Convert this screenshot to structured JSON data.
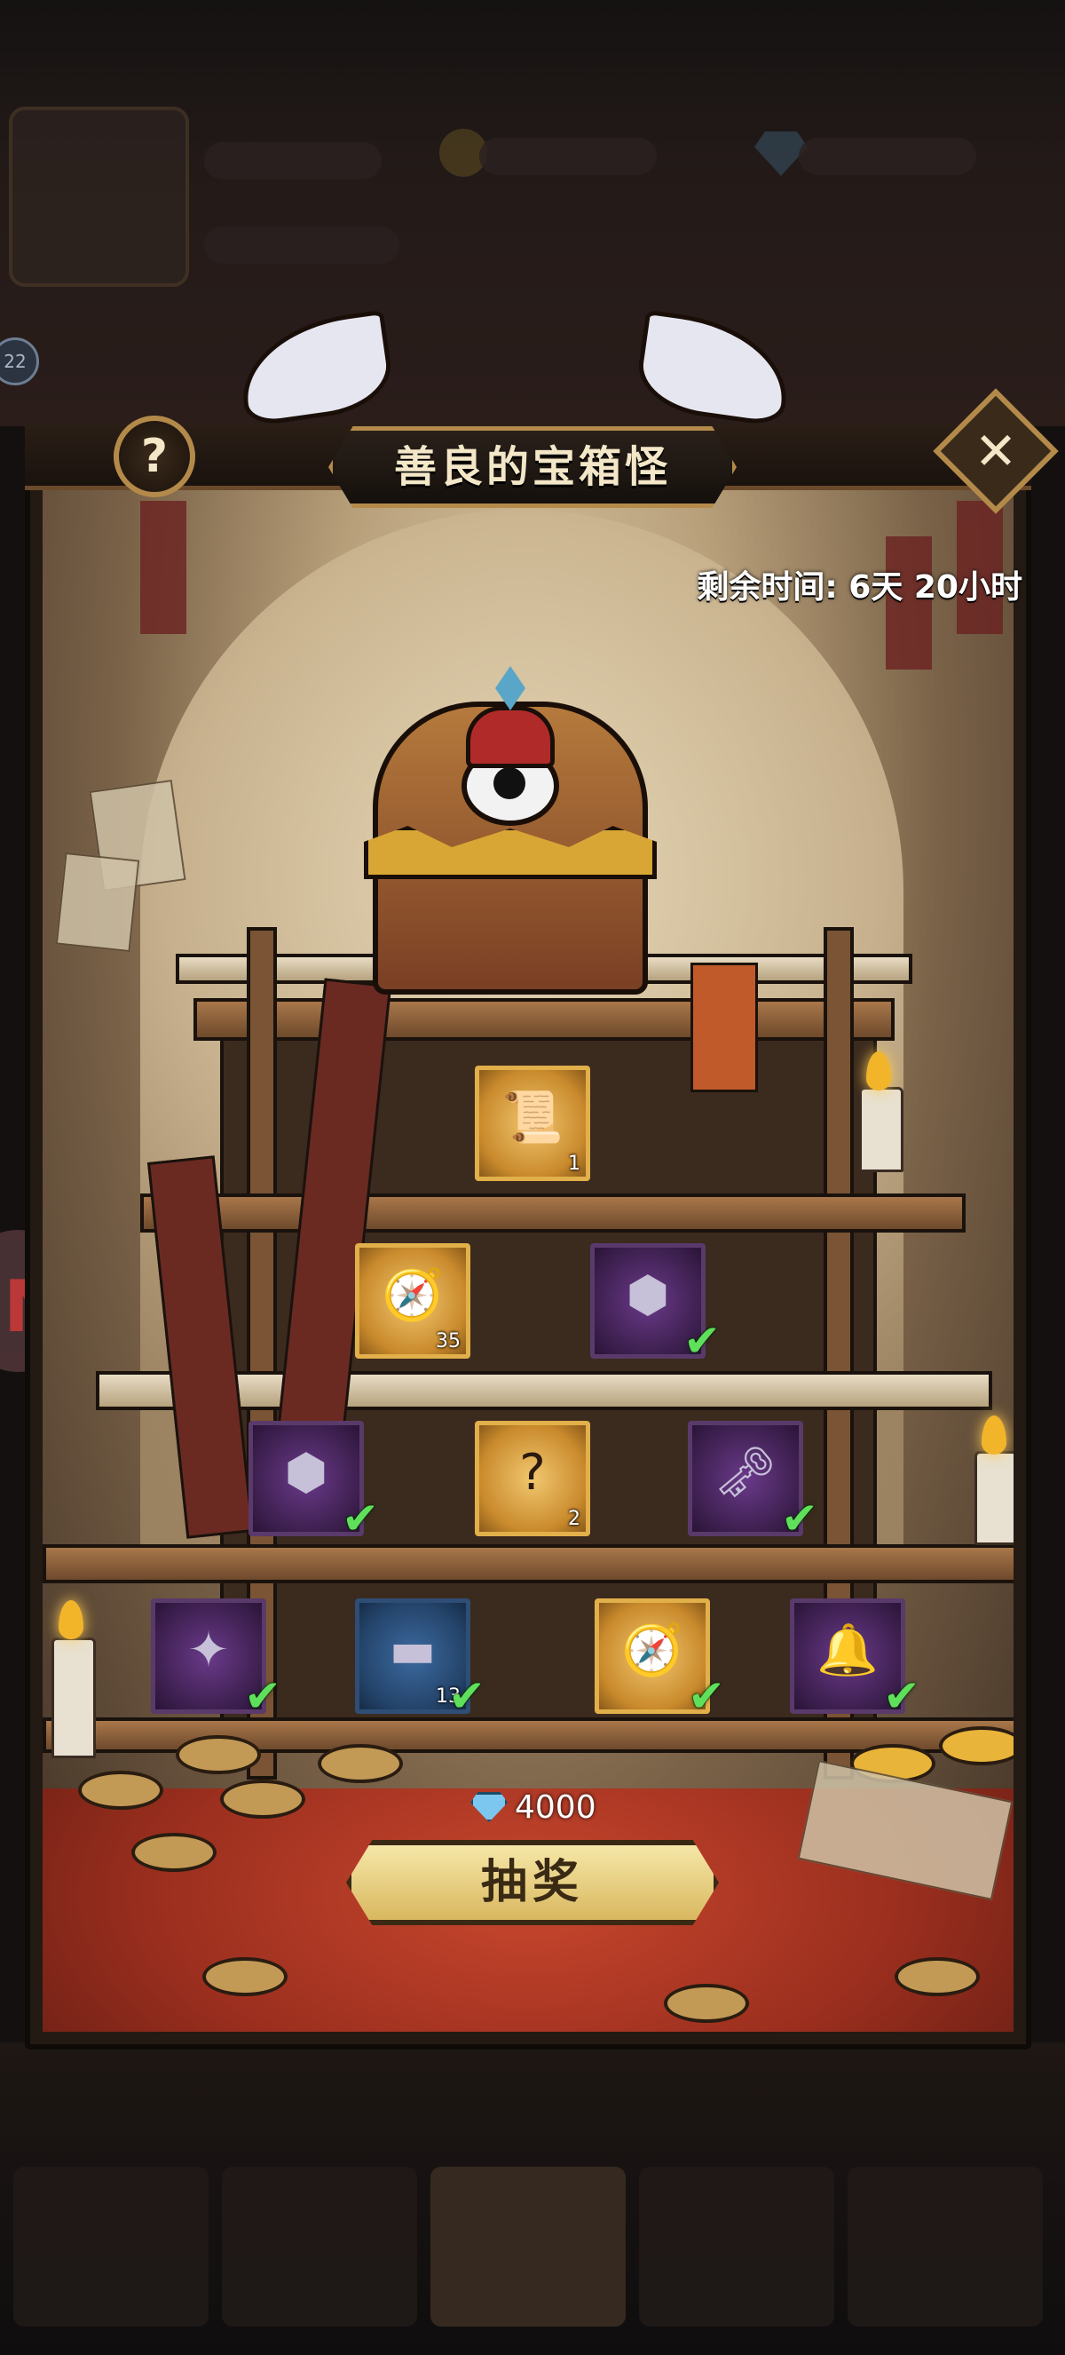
{
  "popup": {
    "title": "善良的宝箱怪",
    "help_label": "?",
    "close_label": "✕",
    "timer": "剩余时间:  6天 20小时"
  },
  "side_badge": "22",
  "rewards": [
    {
      "row": 1,
      "name": "scroll-icon",
      "glyph": "📜",
      "rarity": "gold",
      "count": "1",
      "claimed": false
    },
    {
      "row": 2,
      "name": "compass-icon",
      "glyph": "🧭",
      "rarity": "gold",
      "count": "35",
      "claimed": false
    },
    {
      "row": 2,
      "name": "crystal-box-icon",
      "glyph": "⬢",
      "rarity": "purple",
      "count": "",
      "claimed": true
    },
    {
      "row": 3,
      "name": "crystal-box-icon",
      "glyph": "⬢",
      "rarity": "purple",
      "count": "",
      "claimed": true
    },
    {
      "row": 3,
      "name": "mystery-item-icon",
      "glyph": "?",
      "rarity": "gold",
      "count": "2",
      "claimed": false
    },
    {
      "row": 3,
      "name": "key-icon",
      "glyph": "🗝",
      "rarity": "purple",
      "count": "",
      "claimed": true
    },
    {
      "row": 4,
      "name": "amulet-icon",
      "glyph": "✦",
      "rarity": "purple",
      "count": "",
      "claimed": true
    },
    {
      "row": 4,
      "name": "ingot-icon",
      "glyph": "▬",
      "rarity": "blue",
      "count": "13",
      "claimed": true
    },
    {
      "row": 4,
      "name": "compass-icon",
      "glyph": "🧭",
      "rarity": "gold",
      "count": "",
      "claimed": true
    },
    {
      "row": 4,
      "name": "bell-icon",
      "glyph": "🔔",
      "rarity": "purple",
      "count": "",
      "claimed": true
    }
  ],
  "draw": {
    "cost": "4000",
    "currency_icon": "diamond-icon",
    "button_label": "抽奖"
  },
  "colors": {
    "accent_gold": "#d9b860",
    "claimed_check": "#5fe05a",
    "carpet_red": "#9a2e1e"
  }
}
